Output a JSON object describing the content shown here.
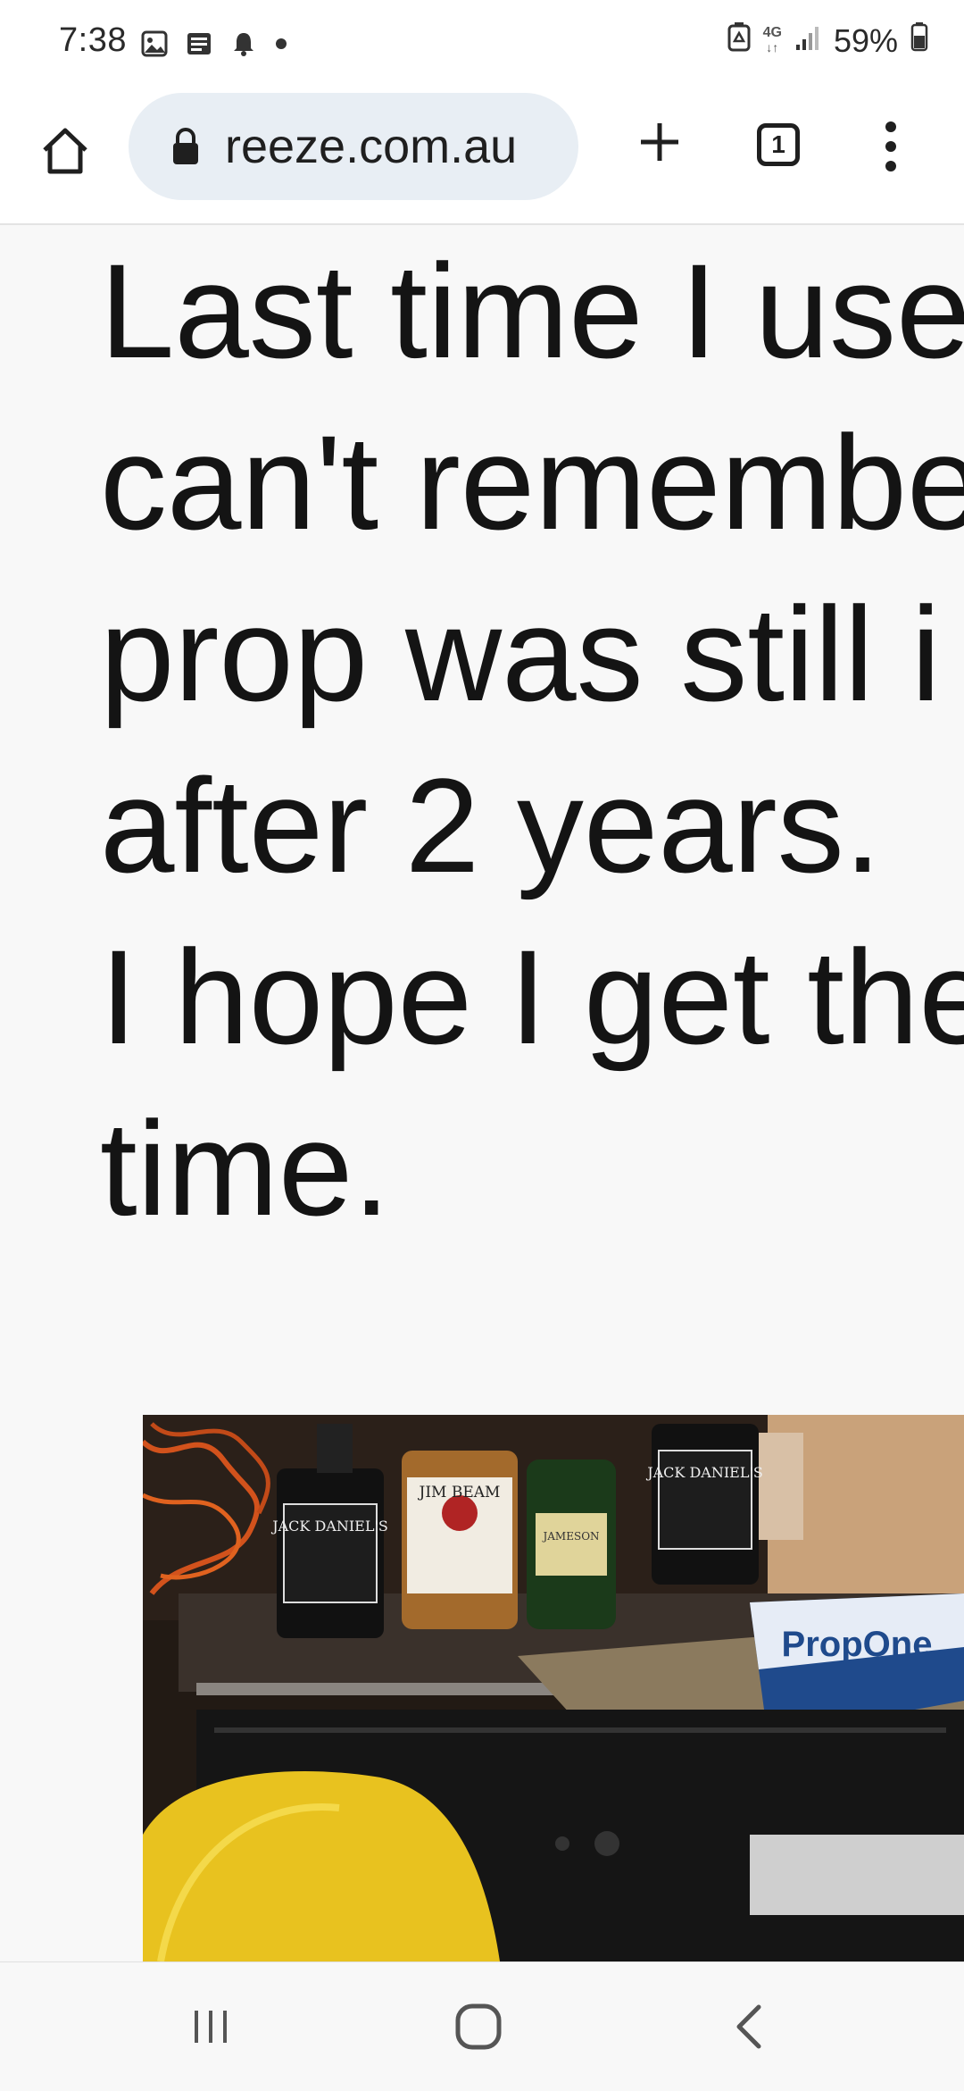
{
  "status_bar": {
    "time": "7:38",
    "network": "4G",
    "battery": "59%",
    "notification_icons": [
      "image-icon",
      "news-icon",
      "bell-icon",
      "dot-icon"
    ]
  },
  "browser": {
    "url": "reeze.com.au",
    "tab_count": "1",
    "icons": [
      "home-icon",
      "lock-icon",
      "plus-icon",
      "tab-switcher-icon",
      "more-vert-icon"
    ]
  },
  "post": {
    "lines": [
      "Last time I use",
      "can't remembe",
      "prop was still i",
      "after 2 years.",
      "I hope I get the",
      "time."
    ]
  },
  "photo": {
    "bottle_labels": [
      "JACK DANIEL'S",
      "JIM BEAM",
      "JAMESON",
      "JACK DANIEL'S"
    ],
    "box_label": "PropOne"
  },
  "nav_bar": {
    "buttons": [
      "recent-apps",
      "home",
      "back"
    ]
  },
  "colors": {
    "toolbar_bg": "#ffffff",
    "url_pill_bg": "#e8eef4",
    "page_bg": "#f8f8f8",
    "text": "#141414"
  }
}
